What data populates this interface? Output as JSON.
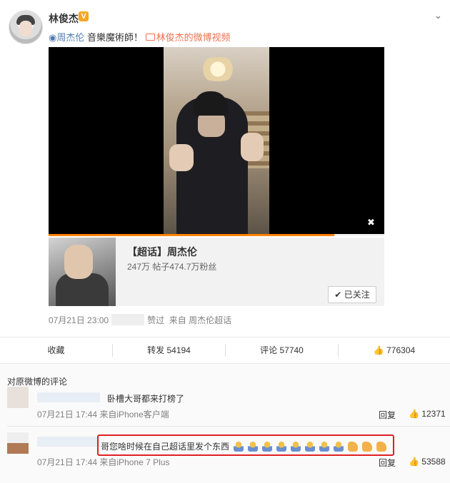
{
  "post": {
    "author": "林俊杰",
    "verified_badge": "V",
    "topic_tag": "周杰伦",
    "text": "音樂魔術師！",
    "video_link": "林俊杰的微博视频",
    "video_progress": 0.85,
    "time": "07月21日 23:00",
    "liked_label": "赞过",
    "source": "来自 周杰伦超话"
  },
  "topic_card": {
    "title": "【超话】周杰伦",
    "stats": "247万 帖子474.7万粉丝",
    "follow_label": "已关注"
  },
  "actions": {
    "favorite": "收藏",
    "repost": "转发 54194",
    "comment": "评论 57740",
    "like": "776304"
  },
  "comments_section": {
    "header": "对原微博的评论",
    "items": [
      {
        "text": "卧槽大哥都来打榜了",
        "time": "07月21日 17:44 来自iPhone客户端",
        "reply": "回复",
        "likes": "12371"
      },
      {
        "text": "哥您啥时候在自己超话里发个东西",
        "time": "07月21日 17:44 来自iPhone 7 Plus",
        "reply": "回复",
        "likes": "53588"
      }
    ]
  },
  "colors": {
    "accent_orange": "#eb7350",
    "link_blue": "#507daf",
    "highlight_red": "#e02020",
    "progress_orange": "#ff8200"
  }
}
